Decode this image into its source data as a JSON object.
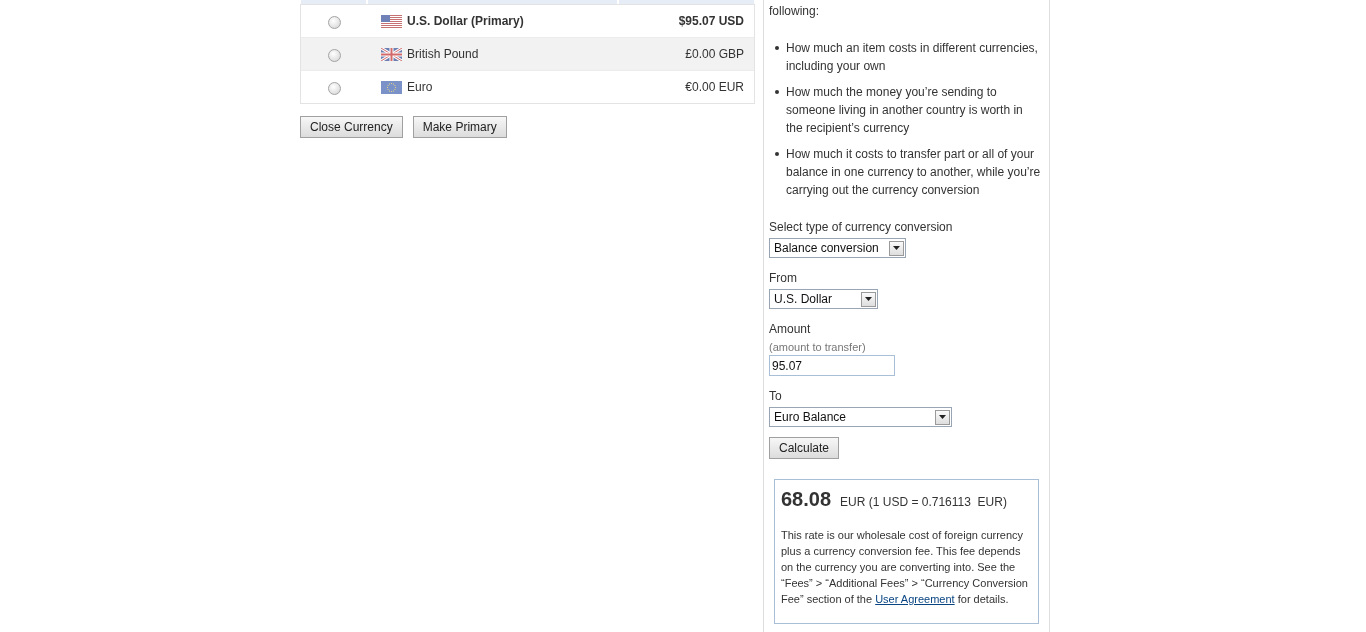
{
  "accounts": {
    "rows": [
      {
        "kind": "us",
        "name": "U.S. Dollar (Primary)",
        "balance": "$95.07 USD",
        "primary": true,
        "selected": false
      },
      {
        "kind": "gb",
        "name": "British Pound",
        "balance": "£0.00 GBP",
        "primary": false,
        "selected": false
      },
      {
        "kind": "eu",
        "name": "Euro",
        "balance": "€0.00 EUR",
        "primary": false,
        "selected": false
      }
    ],
    "buttons": [
      "Close Currency",
      "Make Primary"
    ]
  },
  "converter": {
    "intro_tail": "following:",
    "bullets": [
      "How much an item costs in different currencies, including your own",
      "How much the money you’re sending to someone living in another country is worth in the recipient’s currency",
      "How much it costs to transfer part or all of your balance in one currency to another, while you’re carrying out the currency conversion"
    ],
    "fields": [
      {
        "kind": "select",
        "label": "Select type of currency conversion",
        "value": "Balance conversion"
      },
      {
        "kind": "select",
        "label": "From",
        "value": "U.S. Dollar"
      },
      {
        "kind": "input",
        "label": "Amount",
        "sublabel": "(amount to transfer)",
        "value": "95.07"
      },
      {
        "kind": "select",
        "label": "To",
        "value": "Euro Balance"
      }
    ],
    "button": "Calculate",
    "result": {
      "amount": "68.08",
      "rate": "EUR (1 USD = 0.716113  EUR)",
      "note_before": "This rate is our wholesale cost of foreign currency plus a currency conversion fee. This fee depends on the currency you are converting into. See the “Fees” > “Additional Fees” > “Currency Conversion Fee” section of the ",
      "link": "User Agreement",
      "note_after": " for details."
    }
  }
}
